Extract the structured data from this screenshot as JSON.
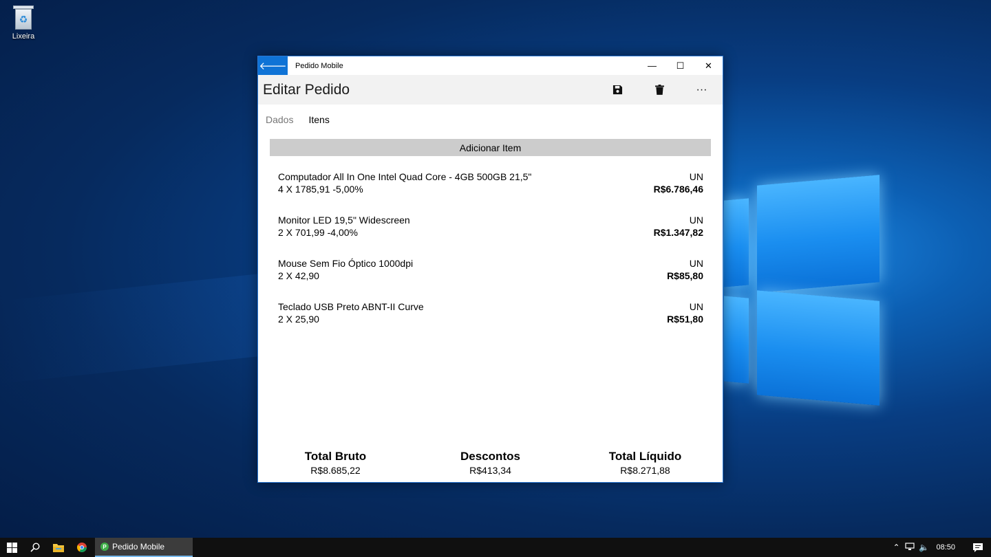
{
  "desktop": {
    "recycle_bin_label": "Lixeira"
  },
  "window": {
    "title": "Pedido Mobile",
    "back_icon": "arrow-left-icon",
    "minimize_glyph": "—",
    "maximize_glyph": "☐",
    "close_glyph": "✕"
  },
  "page": {
    "title": "Editar Pedido",
    "commands": [
      {
        "name": "save-icon",
        "glyph": "💾"
      },
      {
        "name": "delete-icon",
        "glyph": "🗑"
      },
      {
        "name": "more-icon",
        "glyph": "···"
      }
    ]
  },
  "tabs": [
    {
      "label": "Dados",
      "active": false
    },
    {
      "label": "Itens",
      "active": true
    }
  ],
  "add_item_label": "Adicionar Item",
  "items": [
    {
      "name": "Computador All In One Intel Quad Core - 4GB 500GB 21,5\"",
      "detail": "4 X 1785,91 -5,00%",
      "unit": "UN",
      "total": "R$6.786,46"
    },
    {
      "name": "Monitor LED 19,5\" Widescreen",
      "detail": "2 X 701,99 -4,00%",
      "unit": "UN",
      "total": "R$1.347,82"
    },
    {
      "name": "Mouse Sem Fio Óptico 1000dpi",
      "detail": "2 X 42,90",
      "unit": "UN",
      "total": "R$85,80"
    },
    {
      "name": "Teclado USB Preto ABNT-II Curve",
      "detail": "2 X 25,90",
      "unit": "UN",
      "total": "R$51,80"
    }
  ],
  "totals": [
    {
      "label": "Total Bruto",
      "value": "R$8.685,22"
    },
    {
      "label": "Descontos",
      "value": "R$413,34"
    },
    {
      "label": "Total Líquido",
      "value": "R$8.271,88"
    }
  ],
  "taskbar": {
    "app_label": "Pedido Mobile",
    "app_icon_letter": "P",
    "clock": "08:50"
  },
  "colors": {
    "accent": "#0f73d6",
    "add_button_bg": "#cccccc",
    "command_bar_bg": "#f2f2f2"
  }
}
